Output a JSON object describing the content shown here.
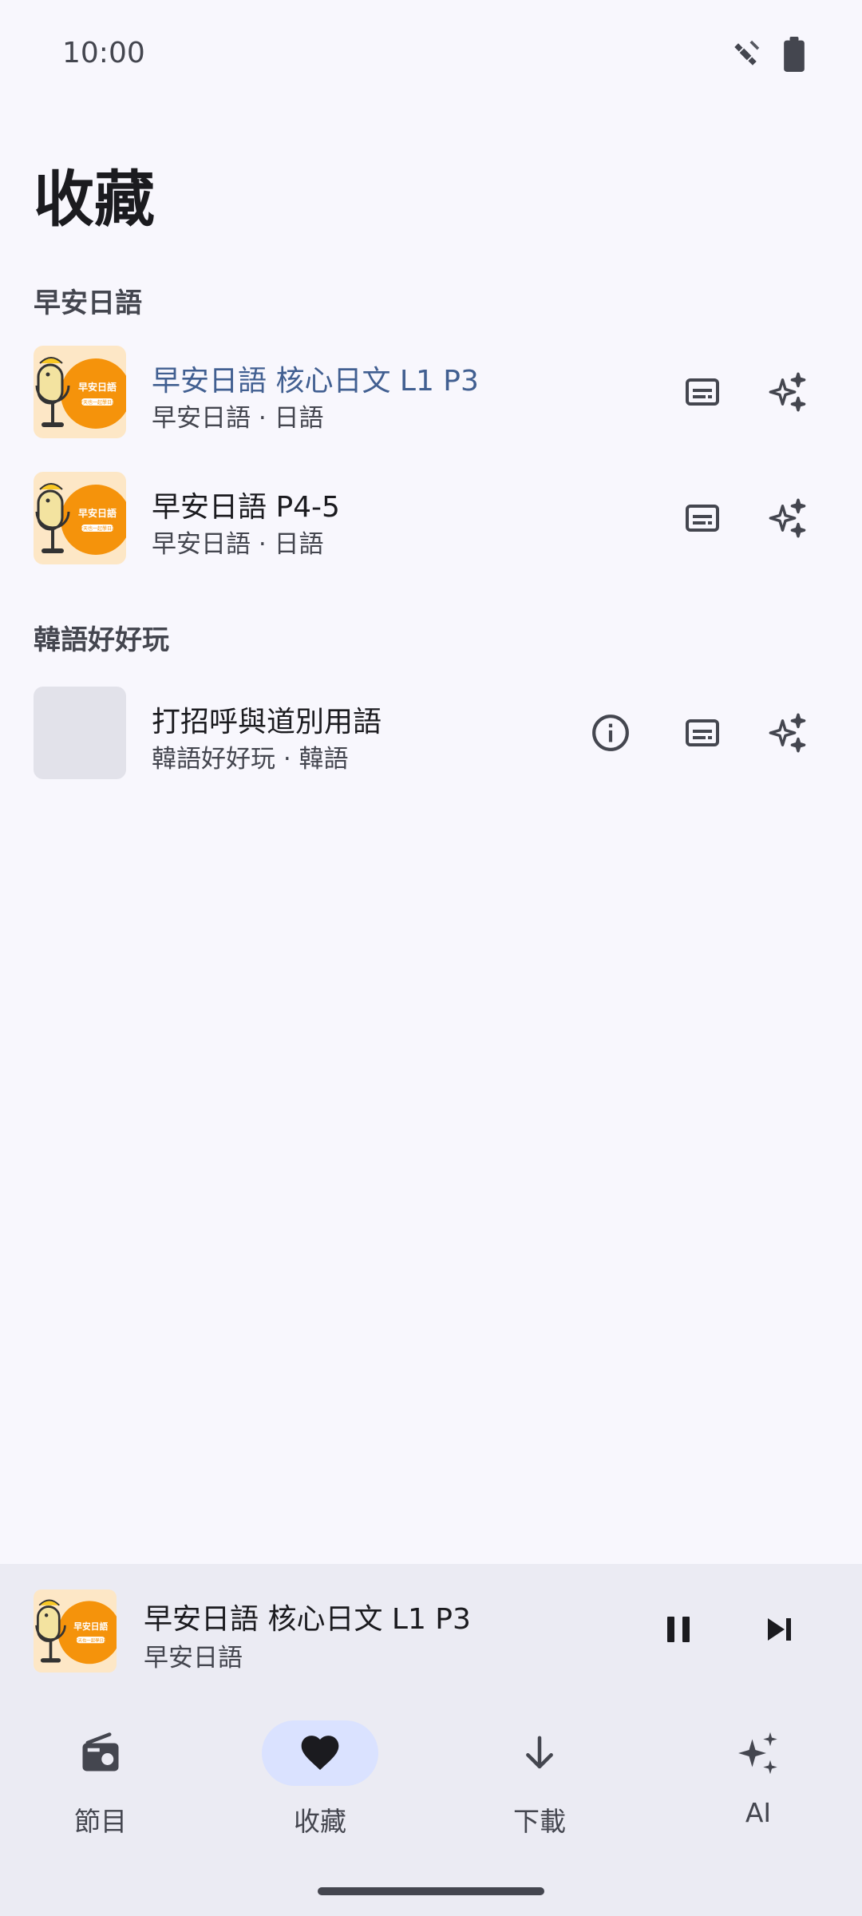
{
  "status_bar": {
    "time": "10:00"
  },
  "page": {
    "title": "收藏"
  },
  "sections": [
    {
      "header": "早安日語",
      "items": [
        {
          "title": "早安日語 核心日文 L1 P3",
          "subtitle": "早安日語 · 日語",
          "active": true,
          "thumb": "podcast-cover"
        },
        {
          "title": "早安日語 P4-5",
          "subtitle": "早安日語 · 日語",
          "active": false,
          "thumb": "podcast-cover"
        }
      ]
    },
    {
      "header": "韓語好好玩",
      "items": [
        {
          "title": "打招呼與道別用語",
          "subtitle": "韓語好好玩 · 韓語",
          "active": false,
          "thumb": "placeholder"
        }
      ]
    }
  ],
  "cover_art": {
    "line1": "早安日語",
    "line2": "今天也一起學日語"
  },
  "mini_player": {
    "title": "早安日語 核心日文 L1 P3",
    "artist": "早安日語",
    "state": "playing"
  },
  "bottom_nav": {
    "items": [
      {
        "label": "節目",
        "icon": "radio-icon"
      },
      {
        "label": "收藏",
        "icon": "heart-icon",
        "active": true
      },
      {
        "label": "下載",
        "icon": "download-icon"
      },
      {
        "label": "AI",
        "icon": "sparkles-icon"
      }
    ]
  },
  "colors": {
    "background": "#f8f7fd",
    "accent": "#415f91",
    "nav_active": "#dae2ff",
    "cover_orange": "#f5930b"
  }
}
